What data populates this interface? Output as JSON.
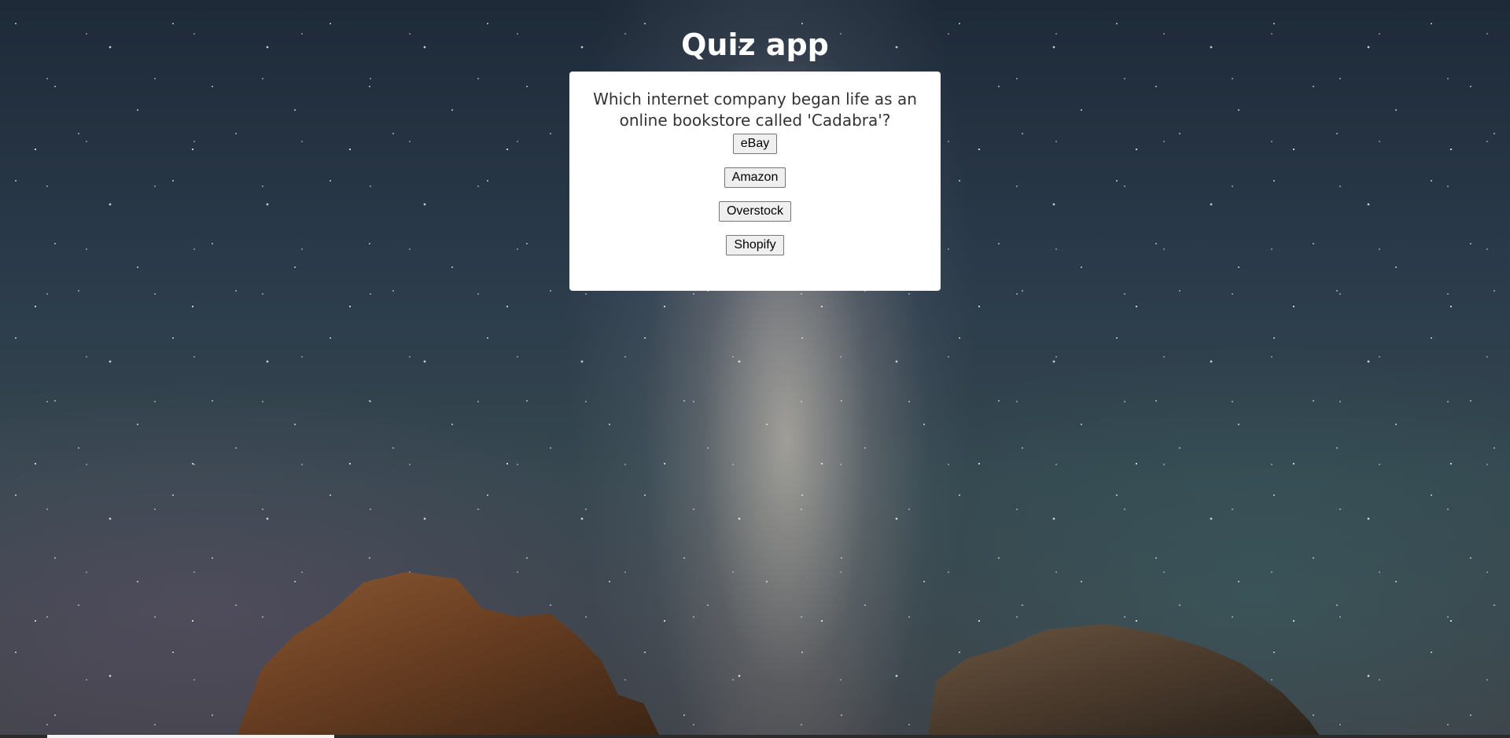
{
  "app": {
    "title": "Quiz app"
  },
  "quiz": {
    "question": "Which internet company began life as an online bookstore called 'Cadabra'?",
    "answers": [
      "eBay",
      "Amazon",
      "Overstock",
      "Shopify"
    ]
  },
  "progress": {
    "fraction": 0.19
  },
  "colors": {
    "card_background": "#ffffff",
    "title_text": "#ffffff",
    "question_text": "#333333"
  }
}
